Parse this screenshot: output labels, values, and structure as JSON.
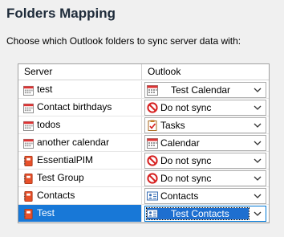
{
  "title": "Folders Mapping",
  "subtitle": "Choose which Outlook folders to sync server data with:",
  "columns": {
    "server": "Server",
    "outlook": "Outlook"
  },
  "rows": [
    {
      "server": "test",
      "server_icon": "calendar-icon",
      "outlook": "Test Calendar",
      "outlook_icon": "calendar-icon",
      "selected": false
    },
    {
      "server": "Contact birthdays",
      "server_icon": "calendar-icon",
      "outlook": "Do not sync",
      "outlook_icon": "no-sync-icon",
      "selected": false
    },
    {
      "server": "todos",
      "server_icon": "calendar-icon",
      "outlook": "Tasks",
      "outlook_icon": "tasks-icon",
      "selected": false
    },
    {
      "server": "another calendar",
      "server_icon": "calendar-icon",
      "outlook": "Calendar",
      "outlook_icon": "calendar-icon",
      "selected": false
    },
    {
      "server": "EssentialPIM",
      "server_icon": "address-book-icon",
      "outlook": "Do not sync",
      "outlook_icon": "no-sync-icon",
      "selected": false
    },
    {
      "server": "Test Group",
      "server_icon": "address-book-icon",
      "outlook": "Do not sync",
      "outlook_icon": "no-sync-icon",
      "selected": false
    },
    {
      "server": "Contacts",
      "server_icon": "address-book-icon",
      "outlook": "Contacts",
      "outlook_icon": "contact-card-icon",
      "selected": false
    },
    {
      "server": "Test",
      "server_icon": "address-book-icon",
      "outlook": "Test Contacts",
      "outlook_icon": "contact-card-icon",
      "selected": true
    }
  ],
  "colors": {
    "selection": "#1878d7",
    "title": "#1e2b3a",
    "no_sync_red": "#d62020",
    "address_book": "#e8502a"
  }
}
